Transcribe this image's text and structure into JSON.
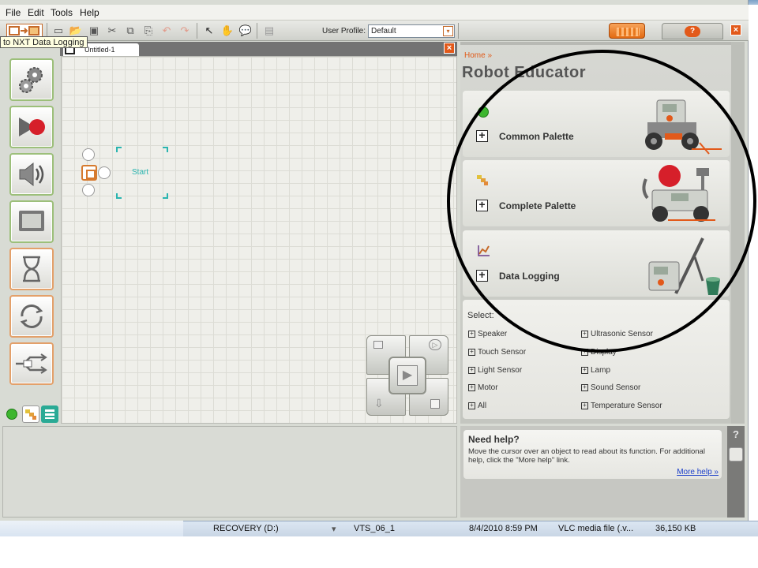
{
  "menu": {
    "file": "File",
    "edit": "Edit",
    "tools": "Tools",
    "help": "Help"
  },
  "toolbar": {
    "profile_label": "User Profile:",
    "profile_value": "Default"
  },
  "tooltip": "to NXT Data Logging",
  "canvas": {
    "tab_label": "Untitled-1",
    "start_label": "Start"
  },
  "robot_educator": {
    "breadcrumb": "Home »",
    "title": "Robot Educator",
    "cards": [
      {
        "label": "Common Palette"
      },
      {
        "label": "Complete Palette"
      },
      {
        "label": "Data Logging"
      }
    ],
    "select_title": "Select:",
    "select_items_left": [
      "Speaker",
      "Touch Sensor",
      "Light Sensor",
      "Motor",
      "All"
    ],
    "select_items_right": [
      "Ultrasonic Sensor",
      "Display",
      "Lamp",
      "Sound Sensor",
      "Temperature Sensor"
    ]
  },
  "help": {
    "title": "Need help?",
    "text": "Move the cursor over an object to read about its function. For additional help, click the \"More help\" link.",
    "link": "More help »"
  },
  "explorer_row": {
    "drive": "RECOVERY (D:)",
    "file": "VTS_06_1",
    "date": "8/4/2010 8:59 PM",
    "type": "VLC media file (.v...",
    "size": "36,150 KB"
  },
  "icons": {
    "palette": [
      "gears-icon",
      "record-play-icon",
      "speaker-icon",
      "display-icon",
      "hourglass-icon",
      "loop-icon",
      "switch-icon"
    ],
    "palette_tabs": [
      "common-palette-icon",
      "complete-palette-icon",
      "custom-palette-icon"
    ]
  },
  "colors": {
    "accent_orange": "#e2591a",
    "start_teal": "#2ab5b0",
    "palette_green": "#9cbf7a"
  }
}
